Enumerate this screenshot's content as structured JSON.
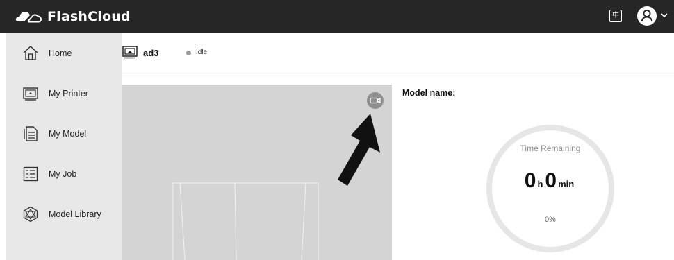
{
  "app": {
    "brand": "FlashCloud",
    "language_button": "中"
  },
  "sidebar": {
    "items": [
      {
        "label": "Home",
        "icon": "home-icon"
      },
      {
        "label": "My Printer",
        "icon": "printer-icon"
      },
      {
        "label": "My Model",
        "icon": "document-icon"
      },
      {
        "label": "My Job",
        "icon": "checklist-icon"
      },
      {
        "label": "Model Library",
        "icon": "polyhedron-icon"
      }
    ]
  },
  "printer": {
    "name": "ad3",
    "status": "Idle",
    "status_color": "#9a9a9a"
  },
  "info": {
    "model_name_label": "Model name:",
    "time_remaining_label": "Time Remaining",
    "hours": "0",
    "hours_unit": "h",
    "minutes": "0",
    "minutes_unit": "min",
    "percent": "0%",
    "progress": 0
  },
  "colors": {
    "topbar": "#262626",
    "sidebar": "#e8e8e8",
    "camera_bg": "#d4d4d4",
    "ring": "#e6e6e6"
  }
}
